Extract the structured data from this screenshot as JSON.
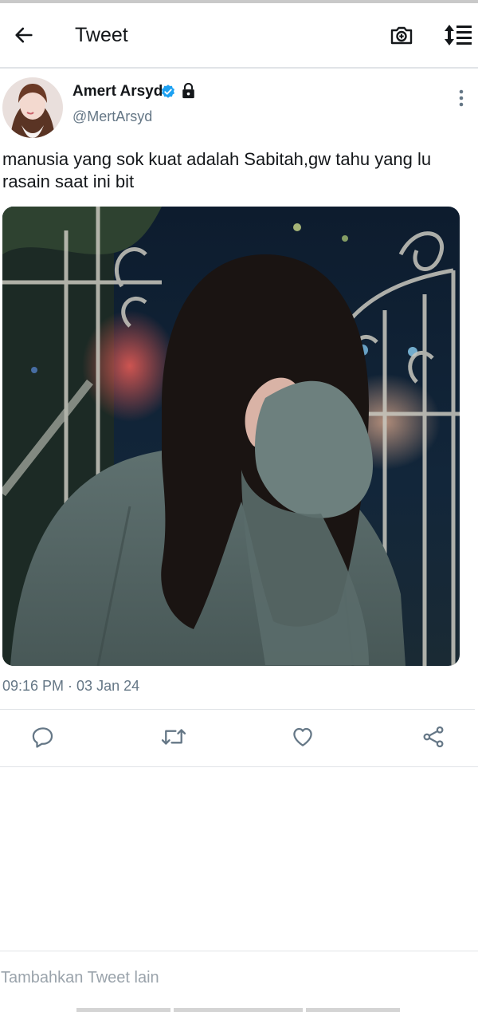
{
  "header": {
    "title": "Tweet",
    "back_icon": "arrow-left-icon",
    "camera_icon": "camera-plus-icon",
    "sort_icon": "sort-list-icon"
  },
  "tweet": {
    "author": {
      "display_name": "Amert Arsyd",
      "handle": "@MertArsyd",
      "verified": true,
      "protected": true
    },
    "text": "manusia yang sok kuat adalah Sabitah,gw tahu yang lu rasain saat ini bit",
    "timestamp": "09:16 PM · 03 Jan 24",
    "actions": {
      "reply_icon": "reply-icon",
      "retweet_icon": "retweet-icon",
      "like_icon": "heart-icon",
      "share_icon": "share-icon"
    }
  },
  "compose": {
    "placeholder": "Tambahkan Tweet lain"
  },
  "colors": {
    "accent": "#1da1f2",
    "text_primary": "#14171a",
    "text_secondary": "#657786",
    "divider": "#e1e4e7"
  }
}
